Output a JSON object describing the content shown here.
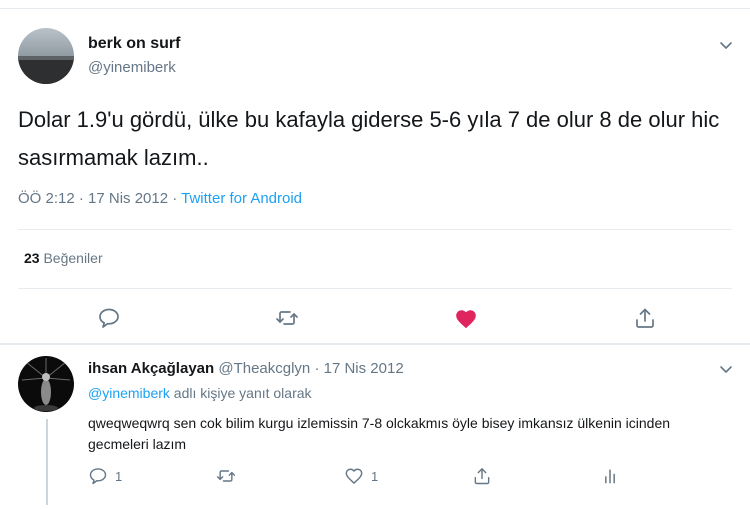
{
  "tweet": {
    "display_name": "berk on surf",
    "handle": "@yinemiberk",
    "text": "Dolar 1.9'u gördü, ülke bu kafayla giderse 5-6 yıla 7 de olur 8 de olur hic sasırmamak lazım..",
    "time_date": "ÖÖ 2:12 · 17 Nis 2012 · ",
    "source": "Twitter for Android",
    "likes_count": "23",
    "likes_label": "Beğeniler",
    "liked": true,
    "like_color": "#e0245e"
  },
  "reply": {
    "display_name": "ihsan Akçağlayan",
    "handle_date": " @Theakcglyn · 17 Nis 2012",
    "replying_mention": "@yinemiberk",
    "replying_suffix": " adlı kişiye yanıt olarak",
    "text": "qweqweqwrq sen cok bilim kurgu izlemissin 7-8 olckakmıs öyle bisey imkansız ülkenin icinden gecmeleri lazım",
    "reply_count": "1",
    "like_count": "1"
  },
  "colors": {
    "accent": "#1da1f2",
    "muted": "#657786",
    "text": "#14171a"
  }
}
